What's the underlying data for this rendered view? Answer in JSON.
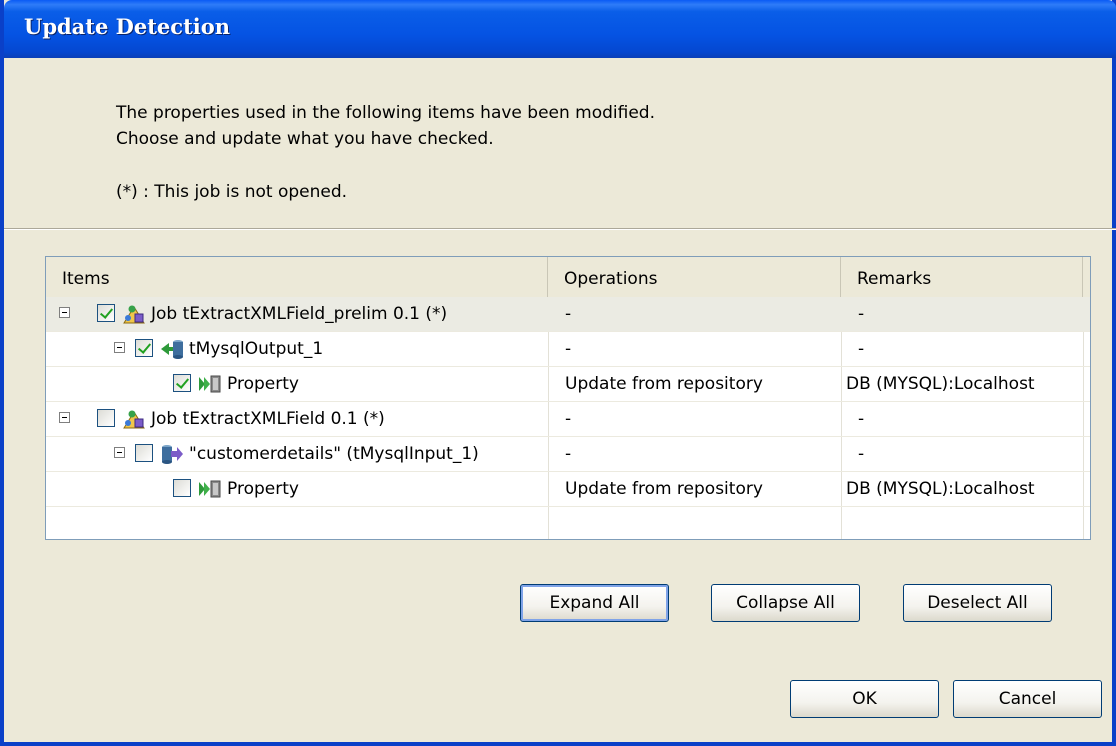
{
  "dialog": {
    "title": "Update Detection",
    "message_line1": "The properties used in the following items have been modified.",
    "message_line2": "Choose and update what you have checked.",
    "note": "(*) : This job is not opened."
  },
  "table": {
    "columns": [
      "Items",
      "Operations",
      "Remarks"
    ],
    "rows": [
      {
        "label": "Job tExtractXMLField_prelim 0.1  (*)",
        "operation": "-",
        "remark": "-",
        "checked": true,
        "level": 0,
        "icon": "job-icon"
      },
      {
        "label": "tMysqlOutput_1",
        "operation": "-",
        "remark": "-",
        "checked": true,
        "level": 1,
        "icon": "mysql-output-icon"
      },
      {
        "label": "Property",
        "operation": "Update from repository",
        "remark": "DB (MYSQL):Localhost",
        "checked": true,
        "level": 2,
        "icon": "property-icon"
      },
      {
        "label": "Job tExtractXMLField 0.1  (*)",
        "operation": "-",
        "remark": "-",
        "checked": false,
        "level": 0,
        "icon": "job-icon"
      },
      {
        "label": "\"customerdetails\" (tMysqlInput_1)",
        "operation": "-",
        "remark": "-",
        "checked": false,
        "level": 1,
        "icon": "mysql-input-icon"
      },
      {
        "label": "Property",
        "operation": "Update from repository",
        "remark": "DB (MYSQL):Localhost",
        "checked": false,
        "level": 2,
        "icon": "property-icon"
      }
    ]
  },
  "buttons": {
    "expand_all": "Expand All",
    "collapse_all": "Collapse All",
    "deselect_all": "Deselect All",
    "ok": "OK",
    "cancel": "Cancel"
  },
  "colors": {
    "titlebar": "#0553e3",
    "dialog_bg": "#ece9d8",
    "checkmark": "#21a121"
  }
}
